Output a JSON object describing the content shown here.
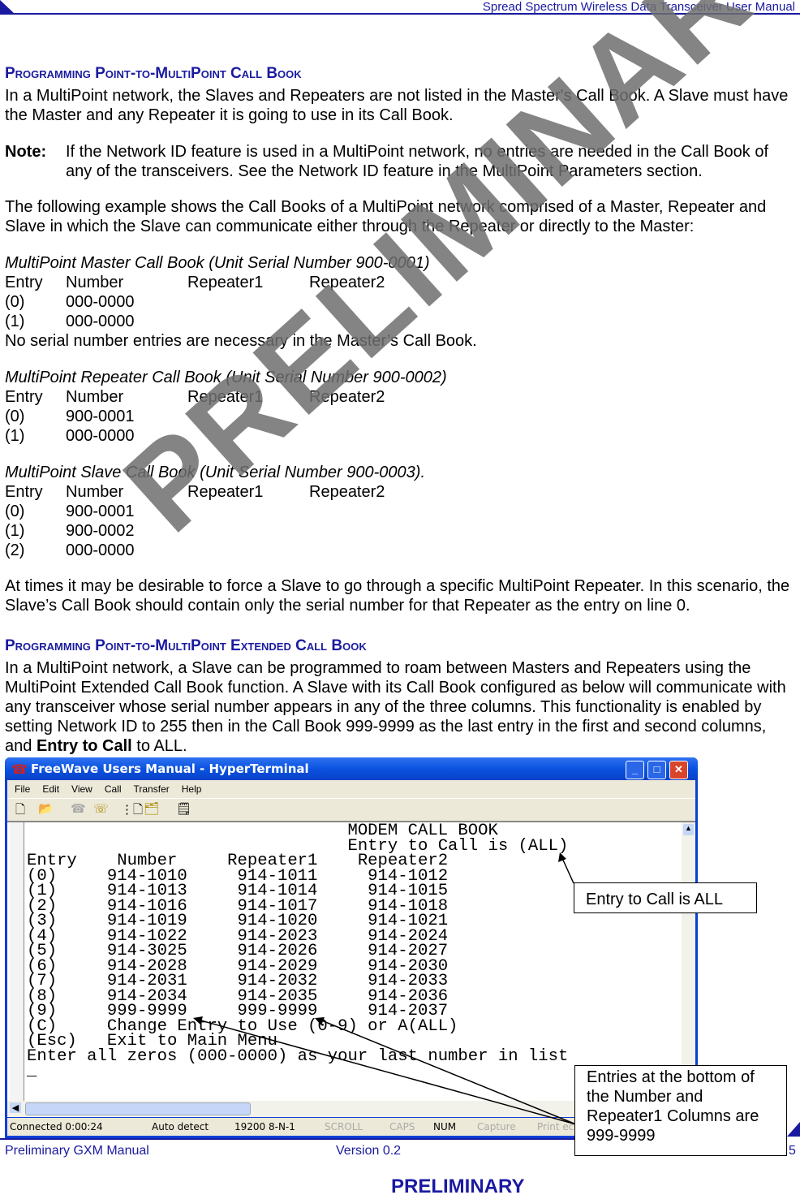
{
  "header": {
    "title": "Spread Spectrum Wireless Data Transceiver User Manual"
  },
  "section1": {
    "heading": "Programming Point-to-MultiPoint Call Book",
    "intro": "In a MultiPoint network, the Slaves and Repeaters are not listed in the Master's Call Book.  A Slave must have the Master and any Repeater it is going to use in its Call Book.",
    "note_label": "Note:",
    "note_text": "If the Network ID feature is used in a MultiPoint network, no entries are needed in the Call Book of any of the transceivers. See the Network ID feature in the MultiPoint Parameters section.",
    "example": "The following example shows the Call Books of a MultiPoint network comprised of a Master, Repeater and Slave in which the Slave can communicate either through the Repeater or directly to the Master:",
    "columns": [
      "Entry",
      "Number",
      "Repeater1",
      "Repeater2"
    ],
    "master": {
      "title": "MultiPoint Master Call Book (Unit Serial Number 900-0001)",
      "rows": [
        [
          "(0)",
          "000-0000"
        ],
        [
          "(1)",
          "000-0000"
        ]
      ],
      "note": "No serial number entries are necessary in the Master’s Call Book."
    },
    "repeater": {
      "title": "MultiPoint Repeater Call Book (Unit Serial Number 900-0002)",
      "rows": [
        [
          "(0)",
          "900-0001"
        ],
        [
          "(1)",
          "000-0000"
        ]
      ]
    },
    "slave": {
      "title": "MultiPoint Slave Call Book (Unit Serial Number 900-0003).",
      "rows": [
        [
          "(0)",
          "900-0001"
        ],
        [
          "(1)",
          "900-0002"
        ],
        [
          "(2)",
          "000-0000"
        ]
      ]
    },
    "force": "At times it may be desirable to force a Slave to go through a specific MultiPoint Repeater. In this scenario, the Slave’s Call Book should contain only the serial number for that Repeater as the entry on line 0."
  },
  "section2": {
    "heading": "Programming Point-to-MultiPoint Extended Call Book",
    "text_a": "In a MultiPoint network, a Slave can be programmed to roam between Masters and Repeaters using the MultiPoint Extended Call Book function.  A Slave with its Call Book configured as below will communicate with any transceiver whose serial number appears in any of the three columns.  This functionality is enabled by setting Network ID to 255 then in the Call Book 999-9999 as the last entry in the first and second columns, and ",
    "text_bold": "Entry to Call",
    "text_b": " to ALL."
  },
  "window": {
    "title": "FreeWave Users Manual - HyperTerminal",
    "menu": [
      "File",
      "Edit",
      "View",
      "Call",
      "Transfer",
      "Help"
    ],
    "toolbar_icons": [
      "new-icon",
      "open-icon",
      "disconnect-icon",
      "dial-icon",
      "send-icon",
      "receive-icon",
      "properties-icon"
    ],
    "terminal_lines": [
      "                                MODEM CALL BOOK",
      "                                Entry to Call is (ALL)",
      "Entry    Number     Repeater1    Repeater2",
      "(0)     914-1010     914-1011     914-1012",
      "(1)     914-1013     914-1014     914-1015",
      "(2)     914-1016     914-1017     914-1018",
      "(3)     914-1019     914-1020     914-1021",
      "(4)     914-1022     914-2023     914-2024",
      "(5)     914-3025     914-2026     914-2027",
      "(6)     914-2028     914-2029     914-2030",
      "(7)     914-2031     914-2032     914-2033",
      "(8)     914-2034     914-2035     914-2036",
      "(9)     999-9999     999-9999     914-2037",
      "(C)     Change Entry to Use (0-9) or A(ALL)",
      "(Esc)   Exit to Main Menu",
      "Enter all zeros (000-0000) as your last number in list",
      "_"
    ],
    "status": [
      "Connected 0:00:24",
      "Auto detect",
      "19200 8-N-1",
      "SCROLL",
      "CAPS",
      "NUM",
      "Capture",
      "Print echo"
    ]
  },
  "callouts": {
    "entry_to_call": "Entry to Call is ALL",
    "bottom_entries": "Entries at the bottom of the Number and Repeater1 Columns are 999-9999"
  },
  "footer": {
    "left": "Preliminary GXM Manual",
    "center": "Version 0.2",
    "page": "5",
    "stamp": "PRELIMINARY"
  },
  "watermark": "PRELIMINARY"
}
